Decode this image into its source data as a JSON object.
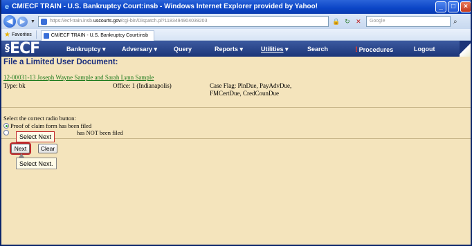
{
  "window": {
    "title": "CM/ECF TRAIN - U.S. Bankruptcy Court:insb - Windows Internet Explorer provided by Yahoo!",
    "controls": [
      "minimize",
      "maximize",
      "close"
    ]
  },
  "browser": {
    "url_prefix": "https://ecf-train.insb.",
    "url_bold": "uscourts.gov",
    "url_rest": "/cgi-bin/Dispatch.pl?1183494904039203",
    "search_placeholder": "Google",
    "favorites_label": "Favorites",
    "tab_label": "CM/ECF TRAIN - U.S. Bankruptcy Court:insb"
  },
  "ecf_menu": {
    "logo": "ECF",
    "items": {
      "bankruptcy": "Bankruptcy",
      "adversary": "Adversary",
      "query": "Query",
      "reports": "Reports",
      "utilities": "Utilities",
      "search": "Search",
      "procedures": "Procedures",
      "logout": "Logout"
    }
  },
  "page": {
    "title": "File a Limited User Document:",
    "case_link": "12-00031-13 Joseph Wayne Sample and Sarah Lynn Sample",
    "type": "Type: bk",
    "office": "Office: 1 (Indianapolis)",
    "case_flag_line1": "Case Flag: PlnDue, PayAdvDue,",
    "case_flag_line2": "FMCertDue, CredCounDue",
    "prompt": "Select the correct radio button:",
    "options": [
      {
        "label": "Proof of claim form has been filed",
        "checked": true
      },
      {
        "label_suffix": "has NOT been filed",
        "checked": false
      }
    ],
    "next_button": "Next",
    "clear_button": "Clear"
  },
  "callouts": {
    "top": "Select Next",
    "bottom": "Select Next."
  },
  "colors": {
    "page_bg": "#f4e4bc",
    "title_color": "#1a2e7e",
    "link_color": "#1b7a1b",
    "menu_bg": "#1c3578",
    "highlight": "#c0282a"
  }
}
